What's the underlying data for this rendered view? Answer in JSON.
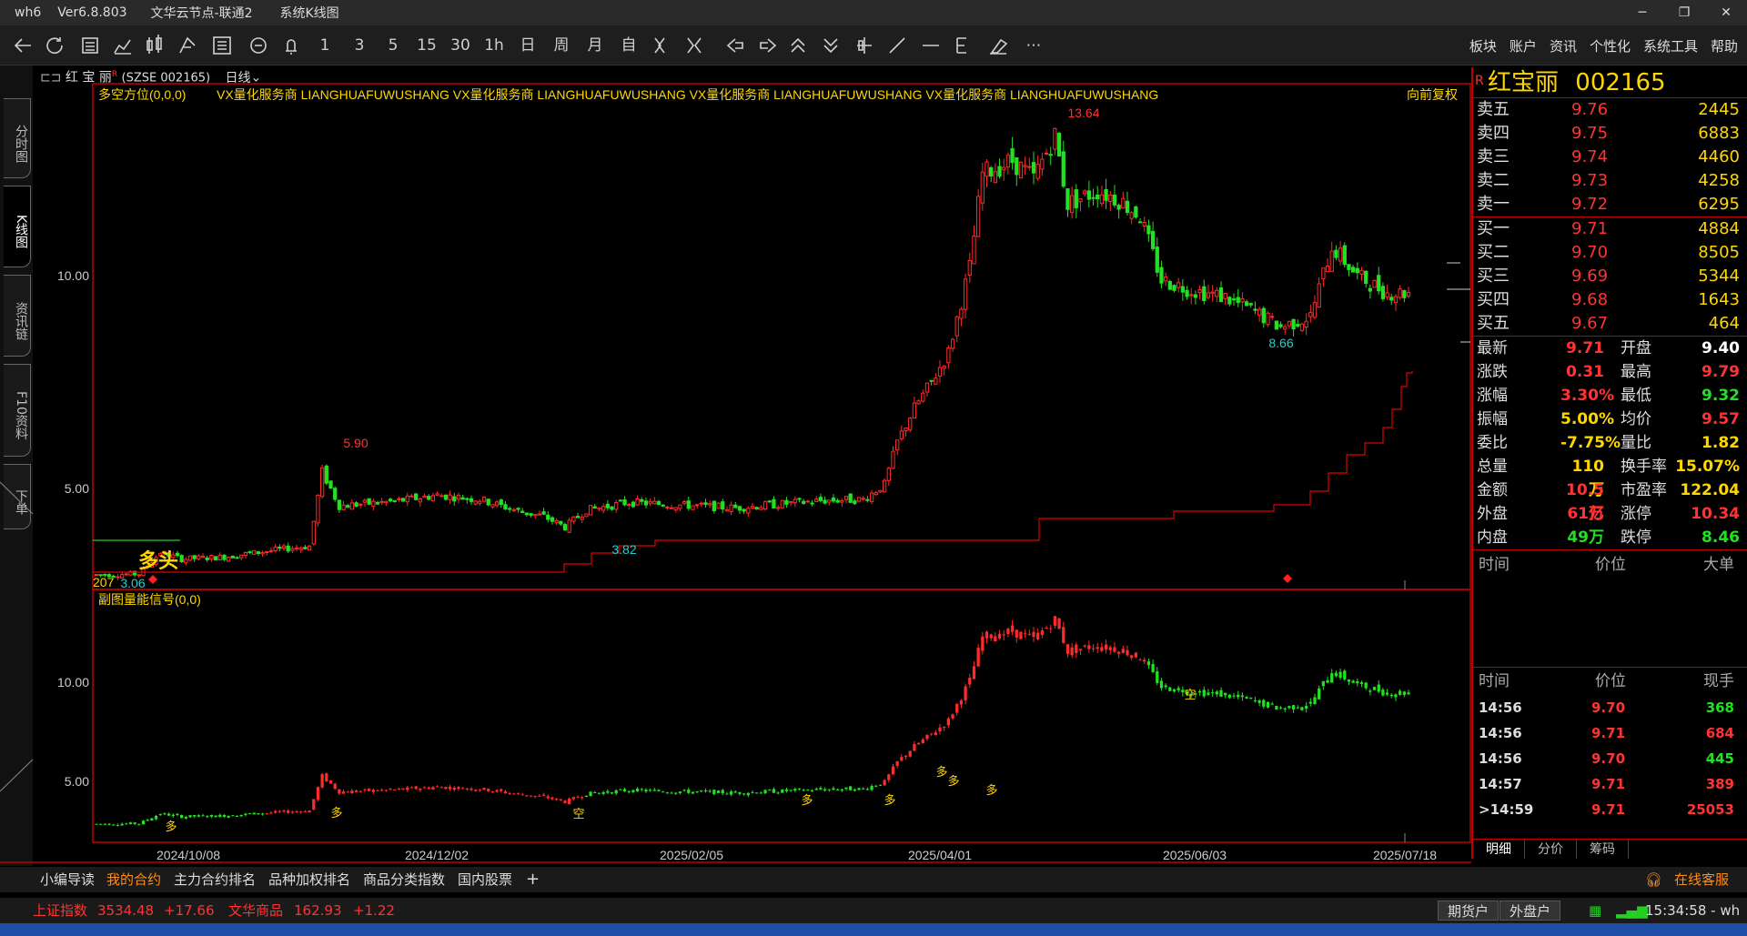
{
  "titlebar": {
    "app": "wh6",
    "version": "Ver6.8.803",
    "server": "文华云节点-联通2",
    "view": "系统K线图",
    "minimize": "─",
    "restore": "❐",
    "close": "✕"
  },
  "toolbar": {
    "periods": [
      "1",
      "3",
      "5",
      "15",
      "30",
      "1h",
      "日",
      "周",
      "月",
      "自"
    ],
    "more": "⋯",
    "menu": [
      "板块",
      "账户",
      "资讯",
      "个性化",
      "系统工具",
      "帮助"
    ]
  },
  "left_tabs": [
    "分时图",
    "K线图",
    "资讯链",
    "F10资料",
    "下单"
  ],
  "quote_header": {
    "name": "红 宝 丽",
    "flag": "R",
    "code": "(SZSE 002165)",
    "period": "日线"
  },
  "main_panel": {
    "indicator": "多空方位(0,0,0)",
    "ad_text": "VX量化服务商  LIANGHUAFUWUSHANG  VX量化服务商  LIANGHUAFUWUSHANG  VX量化服务商  LIANGHUAFUWUSHANG  VX量化服务商  LIANGHUAFUWUSHANG",
    "adjust": "向前复权",
    "signal_text": "多头",
    "left_value": "207",
    "y_ticks": [
      "10.00",
      "5.00"
    ]
  },
  "sub_panel": {
    "indicator": "副图量能信号(0,0)",
    "y_ticks": [
      "10.00",
      "5.00"
    ],
    "signal_long": "多",
    "signal_short": "空"
  },
  "x_dates": [
    "2024/10/08",
    "2024/12/02",
    "2025/02/05",
    "2025/04/01",
    "2025/06/03",
    "2025/07/18"
  ],
  "chart_data": {
    "type": "candlestick",
    "annotations": {
      "high": "13.64",
      "low_1": "3.82",
      "high_1": "5.90",
      "low_2": "8.66",
      "start_low": "3.06"
    }
  },
  "right_panel": {
    "flag": "R",
    "name": "红宝丽",
    "code": "002165",
    "asks": [
      {
        "label": "卖五",
        "price": "9.76",
        "vol": "2445"
      },
      {
        "label": "卖四",
        "price": "9.75",
        "vol": "6883"
      },
      {
        "label": "卖三",
        "price": "9.74",
        "vol": "4460"
      },
      {
        "label": "卖二",
        "price": "9.73",
        "vol": "4258"
      },
      {
        "label": "卖一",
        "price": "9.72",
        "vol": "6295"
      }
    ],
    "bids": [
      {
        "label": "买一",
        "price": "9.71",
        "vol": "4884"
      },
      {
        "label": "买二",
        "price": "9.70",
        "vol": "8505"
      },
      {
        "label": "买三",
        "price": "9.69",
        "vol": "5344"
      },
      {
        "label": "买四",
        "price": "9.68",
        "vol": "1643"
      },
      {
        "label": "买五",
        "price": "9.67",
        "vol": "464"
      }
    ],
    "stats": [
      {
        "l1": "最新",
        "v1": "9.71",
        "c1": "red",
        "l2": "开盘",
        "v2": "9.40",
        "c2": "white"
      },
      {
        "l1": "涨跌",
        "v1": "0.31",
        "c1": "red",
        "l2": "最高",
        "v2": "9.79",
        "c2": "red"
      },
      {
        "l1": "涨幅",
        "v1": "3.30%",
        "c1": "red",
        "l2": "最低",
        "v2": "9.32",
        "c2": "green"
      },
      {
        "l1": "振幅",
        "v1": "5.00%",
        "c1": "yellow",
        "l2": "均价",
        "v2": "9.57",
        "c2": "red"
      },
      {
        "l1": "委比",
        "v1": "-7.75%",
        "c1": "yellow",
        "l2": "量比",
        "v2": "1.82",
        "c2": "yellow"
      },
      {
        "l1": "总量",
        "v1": "110万",
        "c1": "yellow",
        "l2": "换手率",
        "v2": "15.07%",
        "c2": "yellow"
      },
      {
        "l1": "金额",
        "v1": "10.5亿",
        "c1": "red",
        "l2": "市盈率",
        "v2": "122.04",
        "c2": "yellow"
      },
      {
        "l1": "外盘",
        "v1": "61万",
        "c1": "red",
        "l2": "涨停",
        "v2": "10.34",
        "c2": "red"
      },
      {
        "l1": "内盘",
        "v1": "49万",
        "c1": "green",
        "l2": "跌停",
        "v2": "8.46",
        "c2": "green"
      }
    ],
    "big_head": [
      "时间",
      "价位",
      "大单"
    ],
    "tick_head": [
      "时间",
      "价位",
      "现手"
    ],
    "ticks": [
      {
        "time": "14:56",
        "price": "9.70",
        "vol": "368",
        "c": "green"
      },
      {
        "time": "14:56",
        "price": "9.71",
        "vol": "684",
        "c": "red"
      },
      {
        "time": "14:56",
        "price": "9.70",
        "vol": "445",
        "c": "green"
      },
      {
        "time": "14:57",
        "price": "9.71",
        "vol": "389",
        "c": "red"
      },
      {
        "time": ">14:59",
        "price": "9.71",
        "vol": "25053",
        "c": "red"
      }
    ],
    "tabs": [
      "明细",
      "分价",
      "筹码"
    ]
  },
  "bottom_tabs": [
    "小编导读",
    "我的合约",
    "主力合约排名",
    "品种加权排名",
    "商品分类指数",
    "国内股票",
    "+"
  ],
  "service": "在线客服",
  "status": {
    "index1_name": "上证指数",
    "index1_value": "3534.48",
    "index1_change": "+17.66",
    "index2_name": "文华商品",
    "index2_value": "162.93",
    "index2_change": "+1.22",
    "btn_futures": "期货户",
    "btn_foreign": "外盘户",
    "clock": "15:34:58 - wh"
  }
}
